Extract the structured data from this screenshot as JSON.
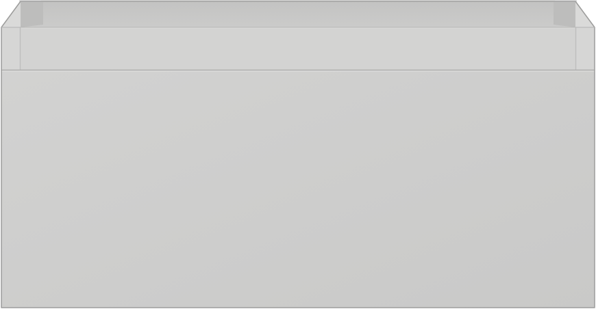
{
  "object": {
    "colors": {
      "front": "#cdcdcc",
      "front_shade": "#c8c8c7",
      "rail": "#d3d3d2",
      "rail_top": "#dedede",
      "inner_back": "#c9c9c8",
      "inner_wall": "#bebebd",
      "side_frame": "#d6d6d5",
      "edge_dark": "#a9a9a8",
      "edge_light": "#e9e9e8",
      "outline": "#9c9c9b",
      "background": "#ffffff"
    }
  }
}
